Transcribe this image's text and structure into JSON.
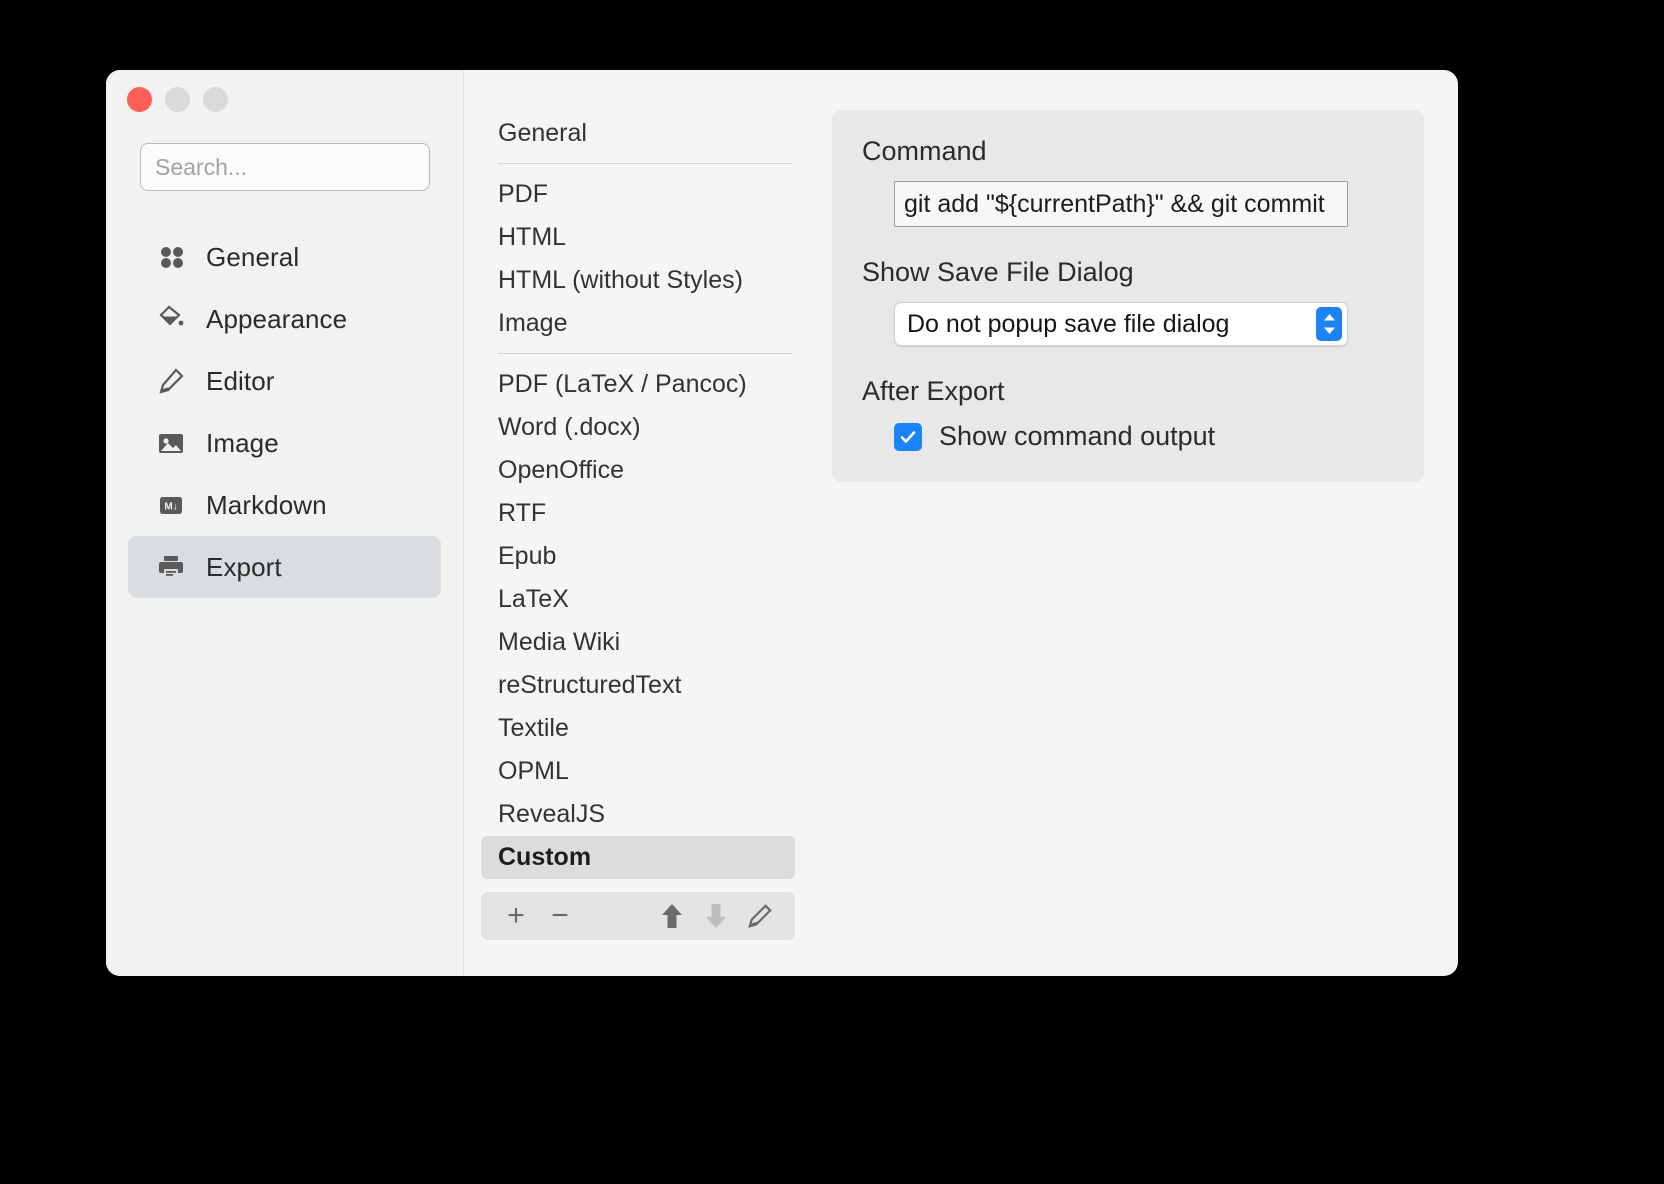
{
  "window": {
    "traffic_lights": {
      "close": "close-button",
      "minimize": "minimize-button",
      "zoom": "zoom-button"
    }
  },
  "search": {
    "placeholder": "Search...",
    "value": ""
  },
  "sidebar": {
    "items": [
      {
        "label": "General",
        "icon": "four-dots-icon",
        "selected": false
      },
      {
        "label": "Appearance",
        "icon": "paint-bucket-icon",
        "selected": false
      },
      {
        "label": "Editor",
        "icon": "pencil-icon",
        "selected": false
      },
      {
        "label": "Image",
        "icon": "image-icon",
        "selected": false
      },
      {
        "label": "Markdown",
        "icon": "markdown-icon",
        "selected": false
      },
      {
        "label": "Export",
        "icon": "printer-icon",
        "selected": true
      }
    ]
  },
  "format_list": {
    "groups": [
      {
        "items": [
          "General"
        ]
      },
      {
        "items": [
          "PDF",
          "HTML",
          "HTML (without Styles)",
          "Image"
        ]
      },
      {
        "items": [
          "PDF (LaTeX / Pancoc)",
          "Word (.docx)",
          "OpenOffice",
          "RTF",
          "Epub",
          "LaTeX",
          "Media Wiki",
          "reStructuredText",
          "Textile",
          "OPML",
          "RevealJS",
          "Custom"
        ]
      }
    ],
    "selected": "Custom",
    "toolbar": {
      "add": "+",
      "remove": "−",
      "move_up": "move-up-arrow",
      "move_down": "move-down-arrow",
      "edit": "pencil-edit"
    }
  },
  "detail": {
    "command": {
      "title": "Command",
      "value": "git add \"${currentPath}\" && git commit"
    },
    "save_dialog": {
      "title": "Show Save File Dialog",
      "selected": "Do not popup save file dialog"
    },
    "after_export": {
      "title": "After Export",
      "checkbox_label": "Show command output",
      "checked": true
    }
  },
  "colors": {
    "accent": "#1b84f7",
    "close": "#ff5f56",
    "selection": "#d9dde0",
    "panel": "#e8e8e8"
  }
}
